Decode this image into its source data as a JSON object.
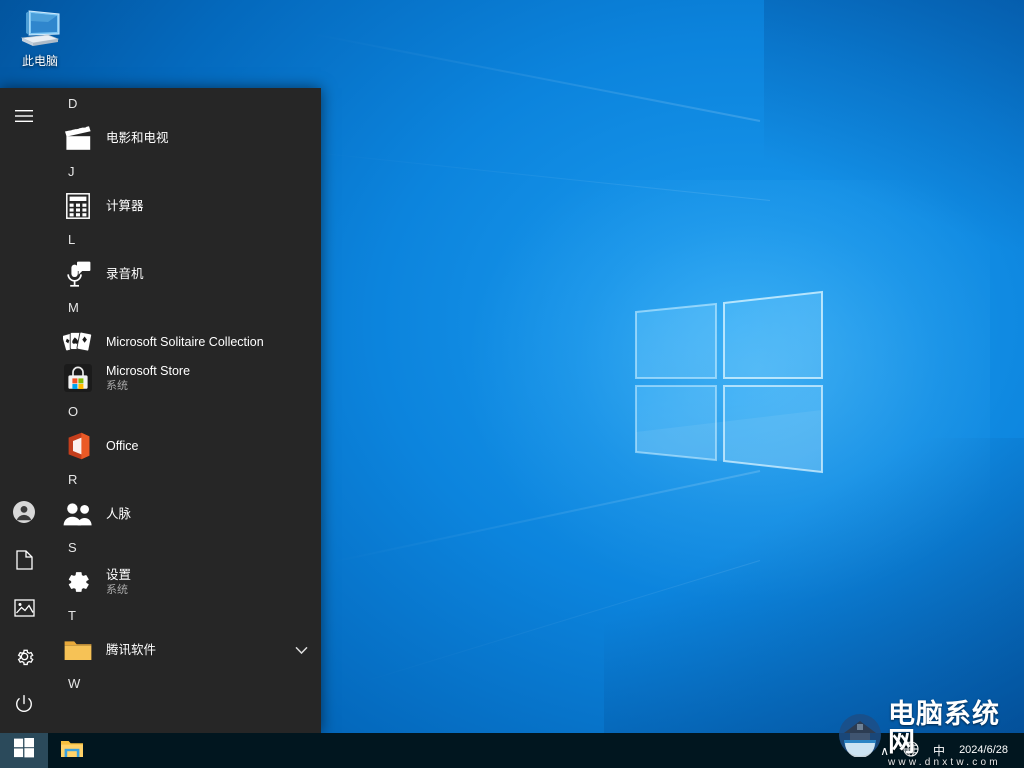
{
  "desktop": {
    "icons": [
      {
        "name": "此电脑",
        "icon": "this-pc-icon"
      }
    ]
  },
  "start_menu": {
    "rail": [
      {
        "id": "hamburger",
        "icon": "hamburger-icon",
        "label": "展开"
      },
      {
        "id": "account",
        "icon": "user-account-icon",
        "label": "账户"
      },
      {
        "id": "documents",
        "icon": "document-icon",
        "label": "文档"
      },
      {
        "id": "pictures",
        "icon": "picture-icon",
        "label": "图片"
      },
      {
        "id": "settings",
        "icon": "gear-icon",
        "label": "设置"
      },
      {
        "id": "power",
        "icon": "power-icon",
        "label": "电源"
      }
    ],
    "sections": [
      {
        "letter": "D",
        "apps": [
          {
            "name": "电影和电视",
            "sub": "",
            "icon": "movies-tv-icon",
            "expandable": false
          }
        ]
      },
      {
        "letter": "J",
        "apps": [
          {
            "name": "计算器",
            "sub": "",
            "icon": "calculator-icon",
            "expandable": false
          }
        ]
      },
      {
        "letter": "L",
        "apps": [
          {
            "name": "录音机",
            "sub": "",
            "icon": "voice-recorder-icon",
            "expandable": false
          }
        ]
      },
      {
        "letter": "M",
        "apps": [
          {
            "name": "Microsoft Solitaire Collection",
            "sub": "",
            "icon": "solitaire-icon",
            "expandable": false
          },
          {
            "name": "Microsoft Store",
            "sub": "系统",
            "icon": "microsoft-store-icon",
            "expandable": false
          }
        ]
      },
      {
        "letter": "O",
        "apps": [
          {
            "name": "Office",
            "sub": "",
            "icon": "office-icon",
            "expandable": false
          }
        ]
      },
      {
        "letter": "R",
        "apps": [
          {
            "name": "人脉",
            "sub": "",
            "icon": "people-icon",
            "expandable": false
          }
        ]
      },
      {
        "letter": "S",
        "apps": [
          {
            "name": "设置",
            "sub": "系统",
            "icon": "gear-icon",
            "expandable": false
          }
        ]
      },
      {
        "letter": "T",
        "apps": [
          {
            "name": "腾讯软件",
            "sub": "",
            "icon": "folder-icon",
            "expandable": true
          }
        ]
      },
      {
        "letter": "W",
        "apps": []
      }
    ]
  },
  "taskbar": {
    "start_button": {
      "icon": "windows-logo-icon",
      "label": "开始"
    },
    "pinned": [
      {
        "name": "文件资源管理器",
        "icon": "file-explorer-icon"
      }
    ],
    "tray": [
      {
        "name": "显示隐藏的图标",
        "icon": "chevron-up-icon",
        "glyph": "∧"
      },
      {
        "name": "网络",
        "icon": "network-globe-icon"
      },
      {
        "name": "输入法",
        "icon": "ime-icon",
        "glyph": "中"
      }
    ],
    "clock": {
      "time": "",
      "date": "2024/6/28"
    }
  },
  "watermark": {
    "title": "电脑系统网",
    "url": "www.dnxtw.com",
    "logo": "house-logo-icon"
  },
  "colors": {
    "start_bg": "#262626",
    "taskbar_bg": "#01161f",
    "start_button_bg": "#2b4a5b",
    "accent_blue": "#0a84d8",
    "text_primary": "#ffffff",
    "text_secondary": "#a8a8a8"
  }
}
